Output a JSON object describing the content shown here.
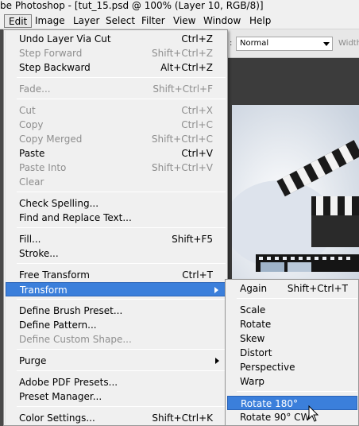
{
  "window": {
    "title": "be Photoshop - [tut_15.psd @ 100% (Layer 10, RGB/8)]"
  },
  "menubar": {
    "items": [
      "Edit",
      "Image",
      "Layer",
      "Select",
      "Filter",
      "View",
      "Window",
      "Help"
    ]
  },
  "options_bar": {
    "blend_mode": "Normal",
    "width_label": "Width"
  },
  "edit_menu": {
    "items": [
      {
        "label": "Undo Layer Via Cut",
        "shortcut": "Ctrl+Z"
      },
      {
        "label": "Step Forward",
        "shortcut": "Shift+Ctrl+Z"
      },
      {
        "label": "Step Backward",
        "shortcut": "Alt+Ctrl+Z"
      },
      {
        "label": "Fade...",
        "shortcut": "Shift+Ctrl+F"
      },
      {
        "label": "Cut",
        "shortcut": "Ctrl+X"
      },
      {
        "label": "Copy",
        "shortcut": "Ctrl+C"
      },
      {
        "label": "Copy Merged",
        "shortcut": "Shift+Ctrl+C"
      },
      {
        "label": "Paste",
        "shortcut": "Ctrl+V"
      },
      {
        "label": "Paste Into",
        "shortcut": "Shift+Ctrl+V"
      },
      {
        "label": "Clear",
        "shortcut": ""
      },
      {
        "label": "Check Spelling...",
        "shortcut": ""
      },
      {
        "label": "Find and Replace Text...",
        "shortcut": ""
      },
      {
        "label": "Fill...",
        "shortcut": "Shift+F5"
      },
      {
        "label": "Stroke...",
        "shortcut": ""
      },
      {
        "label": "Free Transform",
        "shortcut": "Ctrl+T"
      },
      {
        "label": "Transform",
        "shortcut": ""
      },
      {
        "label": "Define Brush Preset...",
        "shortcut": ""
      },
      {
        "label": "Define Pattern...",
        "shortcut": ""
      },
      {
        "label": "Define Custom Shape...",
        "shortcut": ""
      },
      {
        "label": "Purge",
        "shortcut": ""
      },
      {
        "label": "Adobe PDF Presets...",
        "shortcut": ""
      },
      {
        "label": "Preset Manager...",
        "shortcut": ""
      },
      {
        "label": "Color Settings...",
        "shortcut": "Shift+Ctrl+K"
      }
    ]
  },
  "transform_submenu": {
    "items": [
      {
        "label": "Again",
        "shortcut": "Shift+Ctrl+T"
      },
      {
        "label": "Scale",
        "shortcut": ""
      },
      {
        "label": "Rotate",
        "shortcut": ""
      },
      {
        "label": "Skew",
        "shortcut": ""
      },
      {
        "label": "Distort",
        "shortcut": ""
      },
      {
        "label": "Perspective",
        "shortcut": ""
      },
      {
        "label": "Warp",
        "shortcut": ""
      },
      {
        "label": "Rotate 180°",
        "shortcut": ""
      },
      {
        "label": "Rotate 90° CW",
        "shortcut": ""
      }
    ]
  },
  "colors": {
    "highlight": "#3b7fdb",
    "menu_bg": "#f0f0f0",
    "disabled_text": "#8e8e8e"
  }
}
